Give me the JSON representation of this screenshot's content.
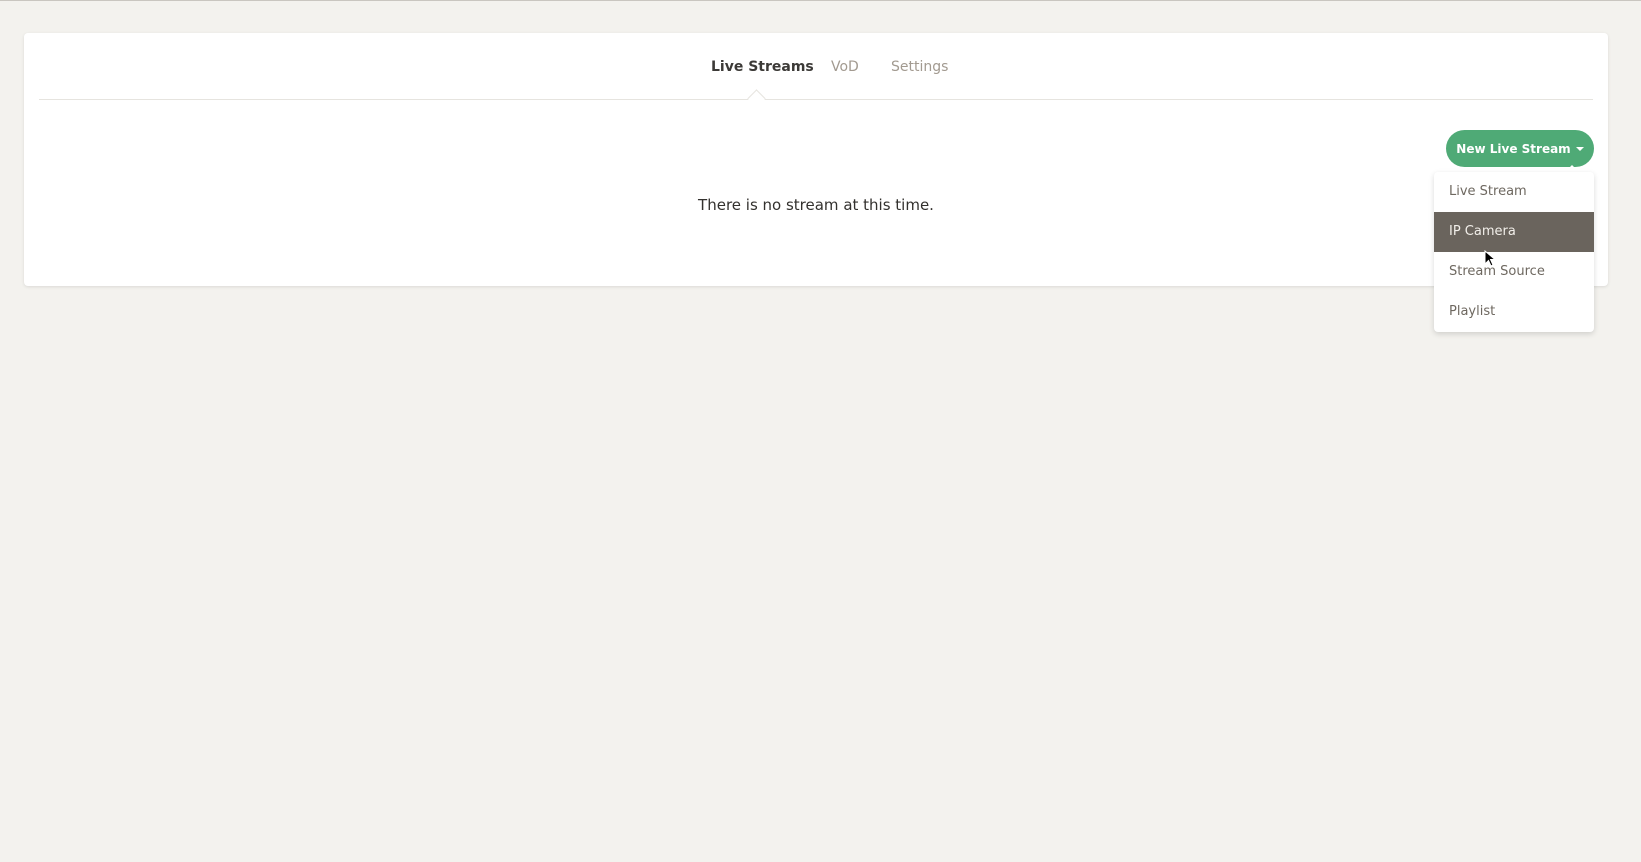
{
  "tabs": [
    {
      "label": "Live Streams",
      "active": true
    },
    {
      "label": "VoD",
      "active": false
    },
    {
      "label": "Settings",
      "active": false
    }
  ],
  "main": {
    "empty_message": "There is no stream at this time."
  },
  "new_stream_button": {
    "label": "New Live Stream",
    "icon": "caret-down-icon"
  },
  "dropdown": {
    "items": [
      {
        "label": "Live Stream"
      },
      {
        "label": "IP Camera",
        "highlighted": true
      },
      {
        "label": "Stream Source"
      },
      {
        "label": "Playlist"
      }
    ]
  },
  "colors": {
    "background": "#f3f2ee",
    "accent": "#4faa76",
    "menu_highlight": "#6a645d",
    "text_active": "#3c3a37",
    "text_muted": "#a29a90"
  }
}
